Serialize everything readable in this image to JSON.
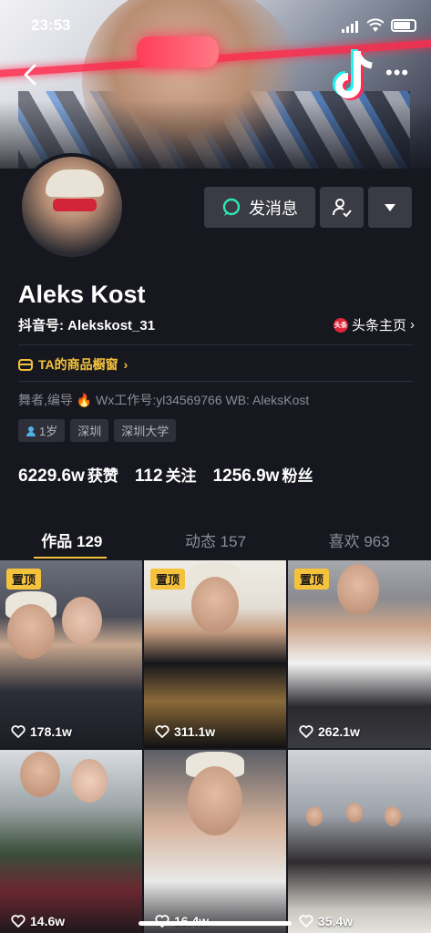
{
  "status_bar": {
    "time": "23:53"
  },
  "header": {
    "back_icon": "back-arrow-icon",
    "more_icon": "more-dots-icon"
  },
  "actions": {
    "message_label": "发消息",
    "follow_icon": "user-check-icon",
    "dropdown_icon": "triangle-down-icon"
  },
  "profile": {
    "name": "Aleks Kost",
    "douyin_id": "抖音号: Alekskost_31",
    "toutiao_label": "头条主页",
    "toutiao_badge": "头条",
    "shop_label": "TA的商品橱窗",
    "bio": "舞者,编导 🔥 Wx工作号:yl34569766  WB: AleksKost",
    "tags": [
      "1岁",
      "深圳",
      "深圳大学"
    ]
  },
  "stats": {
    "likes_value": "6229.6w",
    "likes_label": "获赞",
    "following_value": "112",
    "following_label": "关注",
    "followers_value": "1256.9w",
    "followers_label": "粉丝"
  },
  "tabs": [
    {
      "label": "作品 129"
    },
    {
      "label": "动态 157"
    },
    {
      "label": "喜欢 963"
    }
  ],
  "videos": [
    {
      "pinned": "置顶",
      "likes": "178.1w"
    },
    {
      "pinned": "置顶",
      "likes": "311.1w"
    },
    {
      "pinned": "置顶",
      "likes": "262.1w"
    },
    {
      "likes": "14.6w"
    },
    {
      "likes": "16.4w"
    },
    {
      "likes": "35.4w"
    }
  ],
  "colors": {
    "accent": "#f5c33b",
    "background": "#16171f",
    "button": "#3a3b44"
  }
}
